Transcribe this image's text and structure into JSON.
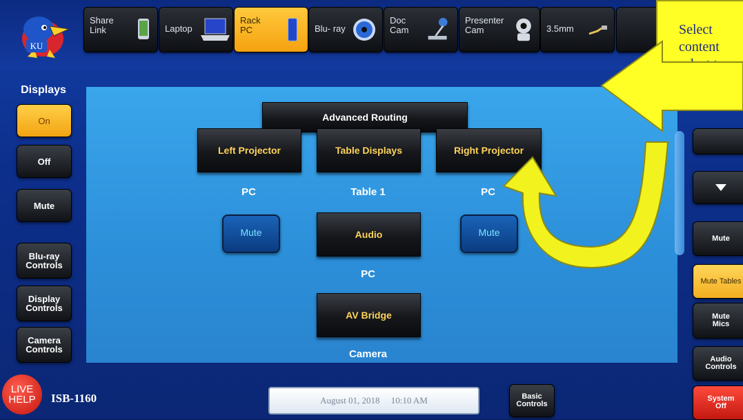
{
  "sources": [
    {
      "label": "Share\nLink",
      "active": false,
      "icon": "phone-icon"
    },
    {
      "label": "Laptop",
      "active": false,
      "icon": "laptop-icon"
    },
    {
      "label": "Rack\nPC",
      "active": true,
      "icon": "pc-tower-icon"
    },
    {
      "label": "Blu- ray",
      "active": false,
      "icon": "disc-icon"
    },
    {
      "label": "Doc\nCam",
      "active": false,
      "icon": "doc-camera-icon"
    },
    {
      "label": "Presenter\nCam",
      "active": false,
      "icon": "ptz-camera-icon"
    },
    {
      "label": "3.5mm",
      "active": false,
      "icon": "audio-cable-icon"
    }
  ],
  "logo": {
    "text": "KU",
    "icon": "jayhawk-logo-icon"
  },
  "left_sidebar": {
    "displays_label": "Displays",
    "on": "On",
    "off": "Off",
    "mute": "Mute",
    "bluray_controls": "Blu-ray\nControls",
    "display_controls": "Display\nControls",
    "camera_controls": "Camera\nControls"
  },
  "main": {
    "advanced_routing": "Advanced Routing",
    "left_projector": "Left Projector",
    "table_displays": "Table Displays",
    "right_projector": "Right Projector",
    "left_source": "PC",
    "table_source": "Table 1",
    "right_source": "PC",
    "left_mute": "Mute",
    "right_mute": "Mute",
    "audio": "Audio",
    "audio_source": "PC",
    "av_bridge": "AV Bridge",
    "av_bridge_source": "Camera"
  },
  "right_sidebar": {
    "mute": "Mute",
    "mute_tables": "Mute Tables",
    "mute_mics": "Mute\nMics",
    "audio_controls": "Audio\nControls",
    "system_off": "System\nOff"
  },
  "footer": {
    "live_help": "LIVE\nHELP",
    "room": "ISB-1160",
    "date": "August 01, 2018",
    "time": "10:10 AM",
    "basic_controls": "Basic\nControls"
  },
  "callout": {
    "text": "Select\ncontent\nselect t"
  },
  "colors": {
    "accent": "#f5a20f",
    "panel": "#2c8fd9",
    "callout": "#ffff25",
    "text_accent": "#ffd45a"
  }
}
